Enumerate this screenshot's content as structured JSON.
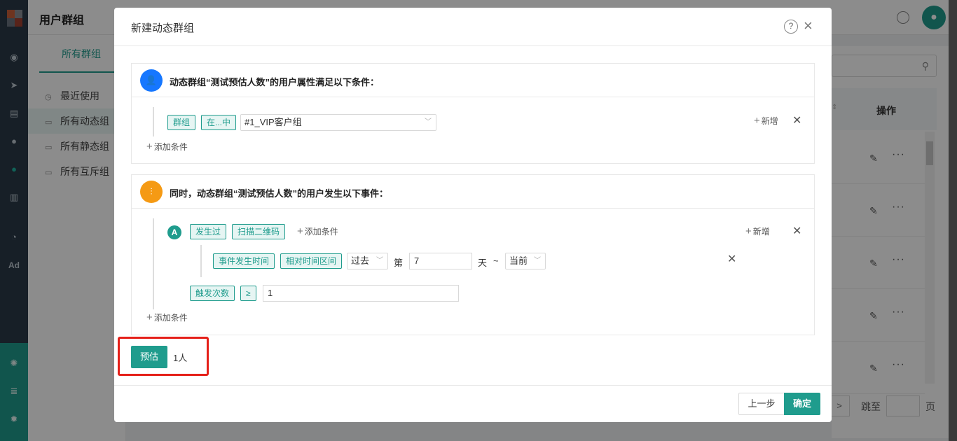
{
  "page": {
    "title": "用户群组",
    "tab_all": "所有群组",
    "menu": [
      {
        "label": "最近使用",
        "icon": "clock-icon"
      },
      {
        "label": "所有动态组",
        "icon": "folder-icon"
      },
      {
        "label": "所有静态组",
        "icon": "folder-icon"
      },
      {
        "label": "所有互斥组",
        "icon": "folder-icon"
      }
    ],
    "table_header_op": "操作",
    "pager": {
      "next": ">",
      "jump": "跳至",
      "page": "页"
    }
  },
  "leftnav": {
    "ad_label": "Ad"
  },
  "modal": {
    "title": "新建动态群组",
    "help": "?",
    "close": "×",
    "card1": {
      "title": "动态群组“测试预估人数”的用户属性满足以下条件：",
      "tag_group": "群组",
      "tag_in": "在...中",
      "group_select": "#1_VIP客户组",
      "add_new": "新增",
      "add_condition": "添加条件"
    },
    "card2": {
      "title": "同时，动态群组“测试预估人数”的用户发生以下事件：",
      "event_label": "A",
      "tag_happened": "发生过",
      "tag_event": "扫描二维码",
      "add_condition_inline": "添加条件",
      "add_new": "新增",
      "tag_time": "事件发生时间",
      "tag_relative": "相对时间区间",
      "past_select": "过去",
      "di": "第",
      "days_value": "7",
      "tian": "天",
      "tilde": "~",
      "now_select": "当前",
      "tag_count": "触发次数",
      "tag_gte": "≥",
      "count_value": "1",
      "add_condition": "添加条件"
    },
    "estimate_button": "预估",
    "estimate_result": "1人",
    "prev_button": "上一步",
    "ok_button": "确定"
  },
  "colors": {
    "accent": "#1f9c8d",
    "badge_blue": "#1677ff",
    "badge_orange": "#f59a14",
    "highlight": "#e52019"
  }
}
